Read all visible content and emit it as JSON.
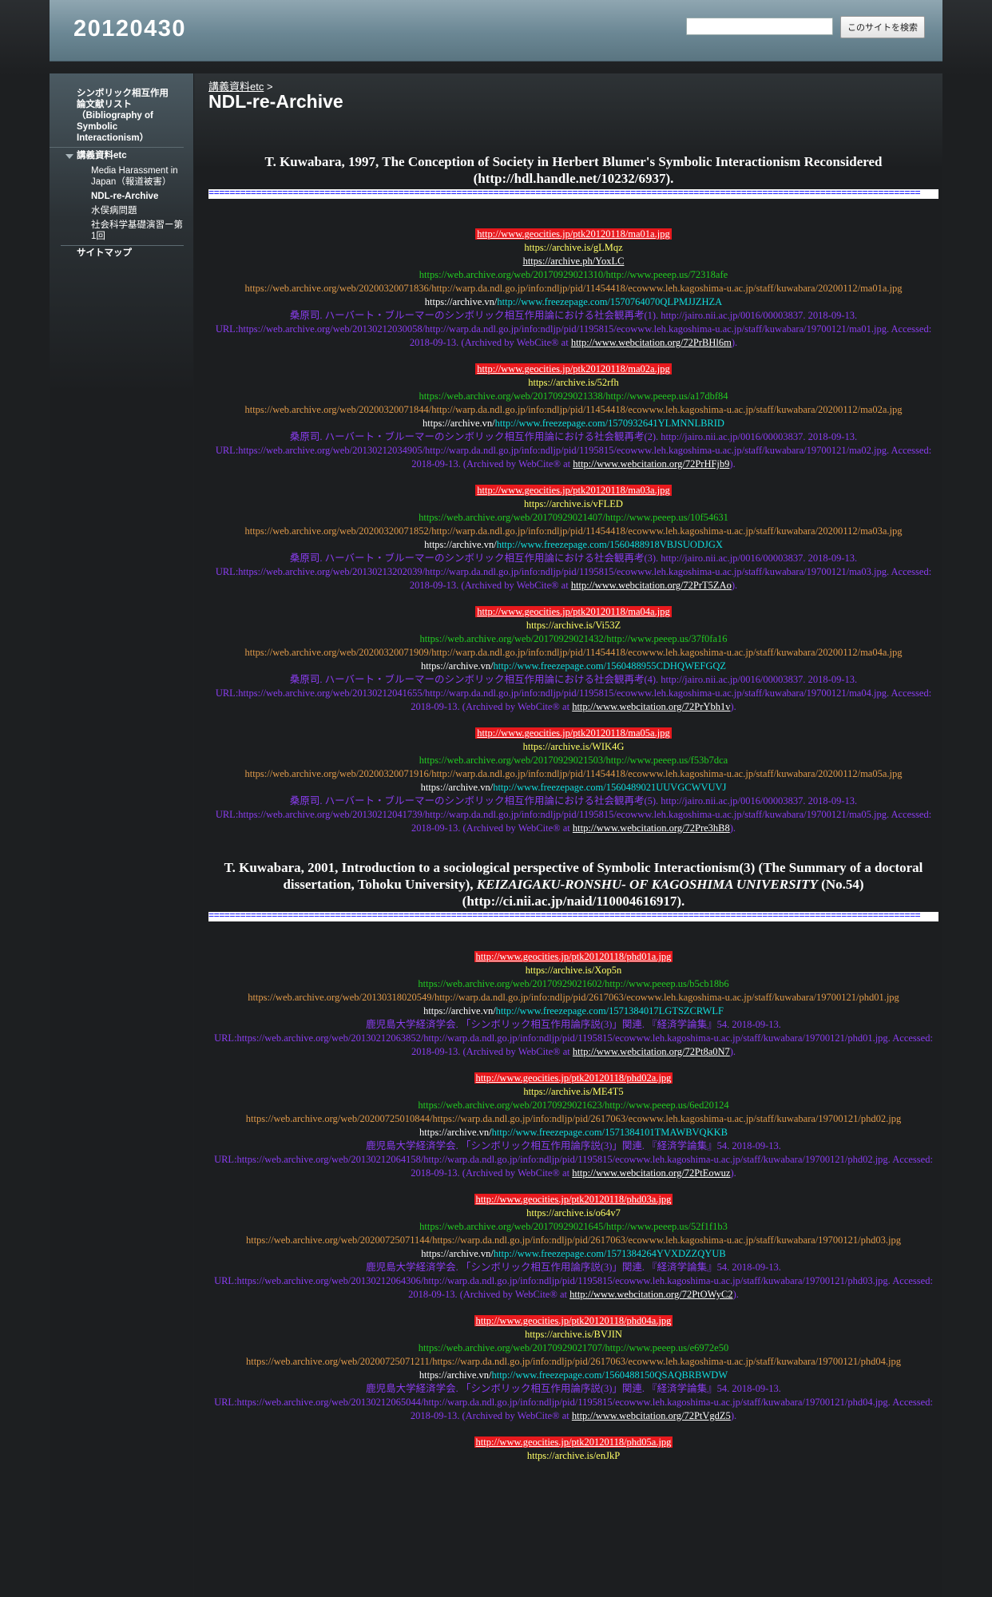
{
  "site_title": "20120430",
  "search": {
    "placeholder": "",
    "button_label": "このサイトを検索"
  },
  "sidebar": {
    "items": [
      {
        "label": "シンボリック相互作用論文献リスト（Bibliography of Symbolic Interactionism）"
      },
      {
        "label": "講義資料etc",
        "children": [
          {
            "label": "Media Harassment in Japan（報道被害）"
          },
          {
            "label": "NDL-re-Archive"
          },
          {
            "label": "水俣病問題"
          },
          {
            "label": "社会科学基礎演習ー第1回"
          }
        ]
      },
      {
        "label": "サイトマップ"
      }
    ]
  },
  "breadcrumb": {
    "link": "講義資料etc",
    "sep": ">"
  },
  "page_title": "NDL-re-Archive",
  "separator": "=======================================================================================================================================",
  "sections": [
    {
      "heading": "T. Kuwabara, 1997, The Conception of Society in Herbert Blumer's Symbolic Interactionism Reconsidered (http://hdl.handle.net/10232/6937).",
      "entries": [
        {
          "geo": "http://www.geocities.jp/ptk20120118/ma01a.jpg",
          "archive_is": "https://archive.is/gLMqz",
          "archive_ph": "https://archive.ph/YoxLC",
          "peeep": "https://web.archive.org/web/20170929021310/http://www.peeep.us/72318afe",
          "warp": "https://web.archive.org/web/20200320071836/http://warp.da.ndl.go.jp/info:ndljp/pid/11454418/ecowww.leh.kagoshima-u.ac.jp/staff/kuwabara/20200112/ma01a.jpg",
          "vn_prefix": "https://archive.vn/",
          "vn_link": "http://www.freezepage.com/1570764070QLPMJJZHZA",
          "cite_text": "桑原司. ハーバート・ブルーマーのシンボリック相互作用論における社会観再考(1). http://jairo.nii.ac.jp/0016/00003837. 2018-09-13. URL:https://web.archive.org/web/20130212030058/http://warp.da.ndl.go.jp/info:ndljp/pid/1195815/ecowww.leh.kagoshima-u.ac.jp/staff/kuwabara/19700121/ma01.jpg. Accessed: 2018-09-13. (Archived by WebCite® at ",
          "webcite": "http://www.webcitation.org/72PrBHl6m",
          "cite_end": ")."
        },
        {
          "geo": "http://www.geocities.jp/ptk20120118/ma02a.jpg",
          "archive_is": "https://archive.is/52rfh",
          "peeep": "https://web.archive.org/web/20170929021338/http://www.peeep.us/a17dbf84",
          "warp": "https://web.archive.org/web/20200320071844/http://warp.da.ndl.go.jp/info:ndljp/pid/11454418/ecowww.leh.kagoshima-u.ac.jp/staff/kuwabara/20200112/ma02a.jpg",
          "vn_prefix": "https://archive.vn/",
          "vn_link": "http://www.freezepage.com/1570932641YLMNNLBRID",
          "cite_text": "桑原司. ハーバート・ブルーマーのシンボリック相互作用論における社会観再考(2). http://jairo.nii.ac.jp/0016/00003837. 2018-09-13. URL:https://web.archive.org/web/20130212034905/http://warp.da.ndl.go.jp/info:ndljp/pid/1195815/ecowww.leh.kagoshima-u.ac.jp/staff/kuwabara/19700121/ma02.jpg. Accessed: 2018-09-13. (Archived by WebCite® at ",
          "webcite": "http://www.webcitation.org/72PrHFjb9",
          "cite_end": ")."
        },
        {
          "geo": "http://www.geocities.jp/ptk20120118/ma03a.jpg",
          "archive_is": "https://archive.is/vFLED",
          "peeep": "https://web.archive.org/web/20170929021407/http://www.peeep.us/10f54631",
          "warp": "https://web.archive.org/web/20200320071852/http://warp.da.ndl.go.jp/info:ndljp/pid/11454418/ecowww.leh.kagoshima-u.ac.jp/staff/kuwabara/20200112/ma03a.jpg",
          "vn_prefix": "https://archive.vn/",
          "vn_link": "http://www.freezepage.com/1560488918VBJSUODJGX",
          "cite_text": "桑原司. ハーバート・ブルーマーのシンボリック相互作用論における社会観再考(3). http://jairo.nii.ac.jp/0016/00003837. 2018-09-13. URL:https://web.archive.org/web/20130213202039/http://warp.da.ndl.go.jp/info:ndljp/pid/1195815/ecowww.leh.kagoshima-u.ac.jp/staff/kuwabara/19700121/ma03.jpg. Accessed: 2018-09-13. (Archived by WebCite® at ",
          "webcite": "http://www.webcitation.org/72PrT5ZAo",
          "cite_end": ")."
        },
        {
          "geo": "http://www.geocities.jp/ptk20120118/ma04a.jpg",
          "archive_is": "https://archive.is/Vi53Z",
          "peeep": "https://web.archive.org/web/20170929021432/http://www.peeep.us/37f0fa16",
          "warp": "https://web.archive.org/web/20200320071909/http://warp.da.ndl.go.jp/info:ndljp/pid/11454418/ecowww.leh.kagoshima-u.ac.jp/staff/kuwabara/20200112/ma04a.jpg",
          "vn_prefix": "https://archive.vn/",
          "vn_link": "http://www.freezepage.com/1560488955CDHQWEFGQZ",
          "cite_text": "桑原司. ハーバート・ブルーマーのシンボリック相互作用論における社会観再考(4). http://jairo.nii.ac.jp/0016/00003837. 2018-09-13. URL:https://web.archive.org/web/20130212041655/http://warp.da.ndl.go.jp/info:ndljp/pid/1195815/ecowww.leh.kagoshima-u.ac.jp/staff/kuwabara/19700121/ma04.jpg. Accessed: 2018-09-13. (Archived by WebCite® at ",
          "webcite": "http://www.webcitation.org/72PrYbh1v",
          "cite_end": ")."
        },
        {
          "geo": "http://www.geocities.jp/ptk20120118/ma05a.jpg",
          "archive_is": "https://archive.is/WIK4G",
          "peeep": "https://web.archive.org/web/20170929021503/http://www.peeep.us/f53b7dca",
          "warp": "https://web.archive.org/web/20200320071916/http://warp.da.ndl.go.jp/info:ndljp/pid/11454418/ecowww.leh.kagoshima-u.ac.jp/staff/kuwabara/20200112/ma05a.jpg",
          "vn_prefix": "https://archive.vn/",
          "vn_link": "http://www.freezepage.com/1560489021UUVGCWVUVJ",
          "cite_text": "桑原司. ハーバート・ブルーマーのシンボリック相互作用論における社会観再考(5). http://jairo.nii.ac.jp/0016/00003837. 2018-09-13. URL:https://web.archive.org/web/20130212041739/http://warp.da.ndl.go.jp/info:ndljp/pid/1195815/ecowww.leh.kagoshima-u.ac.jp/staff/kuwabara/19700121/ma05.jpg. Accessed: 2018-09-13. (Archived by WebCite® at ",
          "webcite": "http://www.webcitation.org/72Pre3hB8",
          "cite_end": ")."
        }
      ]
    },
    {
      "heading_a": "T. Kuwabara, 2001, Introduction to a sociological perspective of Symbolic Interactionism(3) (The Summary of a doctoral dissertation, Tohoku University), ",
      "heading_em": "KEIZAIGAKU-RONSHU- OF KAGOSHIMA UNIVERSITY",
      "heading_b": " (No.54) (http://ci.nii.ac.jp/naid/110004616917).",
      "entries": [
        {
          "geo": "http://www.geocities.jp/ptk20120118/phd01a.jpg",
          "archive_is": "https://archive.is/Xop5n",
          "peeep": "https://web.archive.org/web/20170929021602/http://www.peeep.us/b5cb18b6",
          "warp": "https://web.archive.org/web/20130318020549/http://warp.da.ndl.go.jp/info:ndljp/pid/2617063/ecowww.leh.kagoshima-u.ac.jp/staff/kuwabara/19700121/phd01.jpg",
          "vn_prefix": "https://archive.vn/",
          "vn_link": "http://www.freezepage.com/1571384017LGTSZCRWLF",
          "cite_text": "鹿児島大学経済学会. 「シンボリック相互作用論序説(3)」関連. 『経済学論集』54. 2018-09-13. URL:https://web.archive.org/web/20130212063852/http://warp.da.ndl.go.jp/info:ndljp/pid/1195815/ecowww.leh.kagoshima-u.ac.jp/staff/kuwabara/19700121/phd01.jpg. Accessed: 2018-09-13. (Archived by WebCite® at ",
          "webcite": "http://www.webcitation.org/72Pt8a0N7",
          "cite_end": ")."
        },
        {
          "geo": "http://www.geocities.jp/ptk20120118/phd02a.jpg",
          "archive_is": "https://archive.is/ME4T5",
          "peeep": "https://web.archive.org/web/20170929021623/http://www.peeep.us/6ed20124",
          "warp": "https://web.archive.org/web/20200725010844/https://warp.da.ndl.go.jp/info:ndljp/pid/2617063/ecowww.leh.kagoshima-u.ac.jp/staff/kuwabara/19700121/phd02.jpg",
          "vn_prefix": "https://archive.vn/",
          "vn_link": "http://www.freezepage.com/1571384101TMAWBVQKKB",
          "cite_text": "鹿児島大学経済学会. 「シンボリック相互作用論序説(3)」関連. 『経済学論集』54. 2018-09-13. URL:https://web.archive.org/web/20130212064158/http://warp.da.ndl.go.jp/info:ndljp/pid/1195815/ecowww.leh.kagoshima-u.ac.jp/staff/kuwabara/19700121/phd02.jpg. Accessed: 2018-09-13. (Archived by WebCite® at ",
          "webcite": "http://www.webcitation.org/72PtEowuz",
          "cite_end": ")."
        },
        {
          "geo": "http://www.geocities.jp/ptk20120118/phd03a.jpg",
          "archive_is": "https://archive.is/o64v7",
          "peeep": "https://web.archive.org/web/20170929021645/http://www.peeep.us/52f1f1b3",
          "warp": "https://web.archive.org/web/20200725071144/https://warp.da.ndl.go.jp/info:ndljp/pid/2617063/ecowww.leh.kagoshima-u.ac.jp/staff/kuwabara/19700121/phd03.jpg",
          "vn_prefix": "https://archive.vn/",
          "vn_link": "http://www.freezepage.com/1571384264YVXDZZQYUB",
          "cite_text": "鹿児島大学経済学会. 「シンボリック相互作用論序説(3)」関連. 『経済学論集』54. 2018-09-13. URL:https://web.archive.org/web/20130212064306/http://warp.da.ndl.go.jp/info:ndljp/pid/1195815/ecowww.leh.kagoshima-u.ac.jp/staff/kuwabara/19700121/phd03.jpg. Accessed: 2018-09-13. (Archived by WebCite® at ",
          "webcite": "http://www.webcitation.org/72PtOWyC2",
          "cite_end": ")."
        },
        {
          "geo": "http://www.geocities.jp/ptk20120118/phd04a.jpg",
          "archive_is": "https://archive.is/BVJIN",
          "peeep": "https://web.archive.org/web/20170929021707/http://www.peeep.us/e6972e50",
          "warp": "https://web.archive.org/web/20200725071211/https://warp.da.ndl.go.jp/info:ndljp/pid/2617063/ecowww.leh.kagoshima-u.ac.jp/staff/kuwabara/19700121/phd04.jpg",
          "vn_prefix": "https://archive.vn/",
          "vn_link": "http://www.freezepage.com/1560488150QSAQBRBWDW",
          "cite_text": "鹿児島大学経済学会. 「シンボリック相互作用論序説(3)」関連. 『経済学論集』54. 2018-09-13. URL:https://web.archive.org/web/20130212065044/http://warp.da.ndl.go.jp/info:ndljp/pid/1195815/ecowww.leh.kagoshima-u.ac.jp/staff/kuwabara/19700121/phd04.jpg. Accessed: 2018-09-13. (Archived by WebCite® at ",
          "webcite": "http://www.webcitation.org/72PtVgdZ5",
          "cite_end": ")."
        },
        {
          "geo": "http://www.geocities.jp/ptk20120118/phd05a.jpg",
          "archive_is": "https://archive.is/enJkP"
        }
      ]
    }
  ]
}
